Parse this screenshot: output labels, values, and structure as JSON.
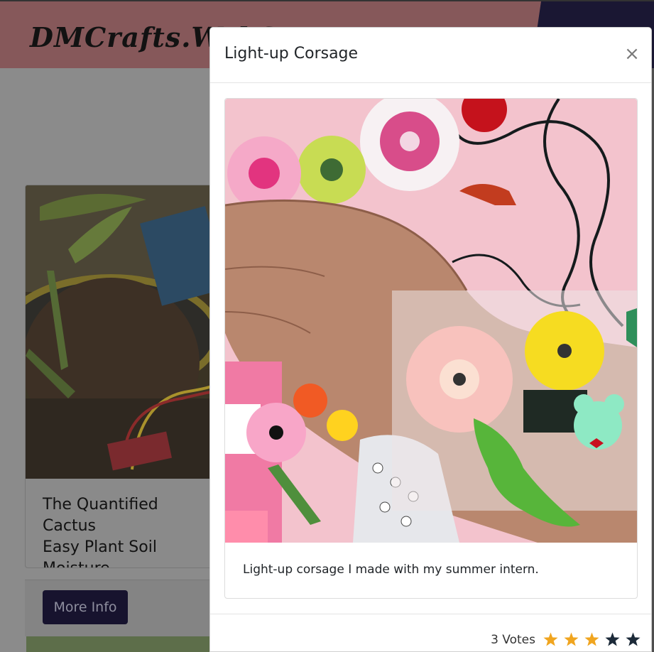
{
  "brand": {
    "title": "DMCrafts.WebS"
  },
  "card": {
    "title": "The Quantified Cactus\nEasy Plant Soil Moisture\nSensor",
    "more_info_label": "More Info"
  },
  "modal": {
    "title": "Light-up Corsage",
    "close_label": "×",
    "caption": "Light-up corsage I made with my summer intern.",
    "votes_label": "3 Votes",
    "rating": 3,
    "max_rating": 5
  },
  "colors": {
    "header_bg": "#86585a",
    "header_dark": "#1a1733",
    "button_bg": "#17132e",
    "star_filled": "#f0a51f",
    "star_empty": "#1c2a39"
  },
  "icons": {
    "close": "close-icon",
    "star": "star-icon"
  }
}
